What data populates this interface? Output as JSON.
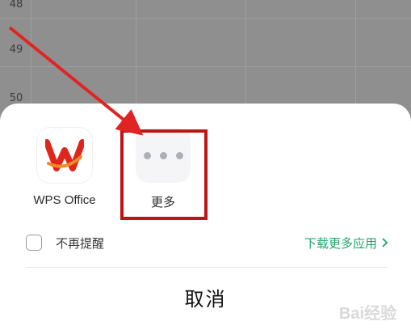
{
  "background": {
    "row_numbers": [
      "48",
      "49",
      "50"
    ]
  },
  "share_sheet": {
    "apps": [
      {
        "label": "WPS Office",
        "icon": "wps-office-icon"
      },
      {
        "label": "更多",
        "icon": "more-dots-icon"
      }
    ],
    "dont_remind_label": "不再提醒",
    "download_more_label": "下载更多应用",
    "cancel_label": "取消"
  },
  "watermark": "Bai经验",
  "colors": {
    "accent_green": "#1fa36a",
    "annotation_red": "#c01414",
    "wps_red": "#e0261b"
  }
}
